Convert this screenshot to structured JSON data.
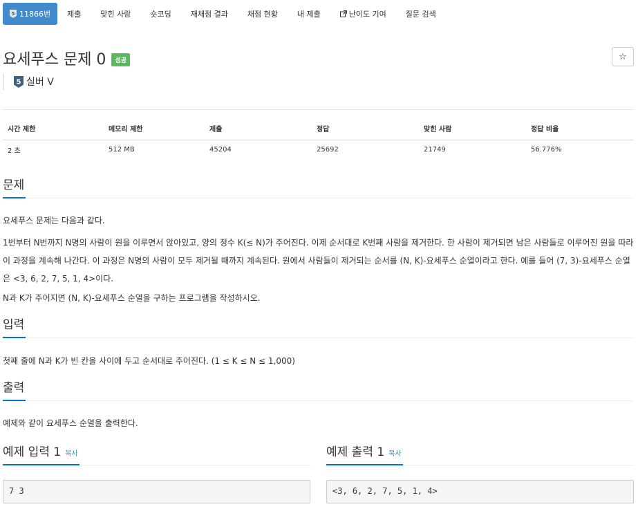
{
  "nav": {
    "problem_number": "11866번",
    "items": [
      "제출",
      "맞힌 사람",
      "숏코딩",
      "재채점 결과",
      "채점 현황",
      "내 제출",
      "난이도 기여",
      "질문 검색"
    ]
  },
  "problem": {
    "title": "요세푸스 문제 0",
    "badge": "성공",
    "star": "☆",
    "tier_digit": "5",
    "tier_label": "실버 V"
  },
  "info": {
    "headers": [
      "시간 제한",
      "메모리 제한",
      "제출",
      "정답",
      "맞힌 사람",
      "정답 비율"
    ],
    "values": [
      "2 초",
      "512 MB",
      "45204",
      "25692",
      "21749",
      "56.776%"
    ]
  },
  "sections": {
    "problem_heading": "문제",
    "problem_p1": "요세푸스 문제는 다음과 같다.",
    "problem_p2": "1번부터 N번까지 N명의 사람이 원을 이루면서 앉아있고, 양의 정수 K(≤ N)가 주어진다. 이제 순서대로 K번째 사람을 제거한다. 한 사람이 제거되면 남은 사람들로 이루어진 원을 따라 이 과정을 계속해 나간다. 이 과정은 N명의 사람이 모두 제거될 때까지 계속된다. 원에서 사람들이 제거되는 순서를 (N, K)-요세푸스 순열이라고 한다. 예를 들어 (7, 3)-요세푸스 순열은 <3, 6, 2, 7, 5, 1, 4>이다.",
    "problem_p3": "N과 K가 주어지면 (N, K)-요세푸스 순열을 구하는 프로그램을 작성하시오.",
    "input_heading": "입력",
    "input_text": "첫째 줄에 N과 K가 빈 칸을 사이에 두고 순서대로 주어진다. (1 ≤ K ≤ N ≤ 1,000)",
    "output_heading": "출력",
    "output_text": "예제와 같이 요세푸스 순열을 출력한다."
  },
  "samples": {
    "input_heading": "예제 입력 1",
    "output_heading": "예제 출력 1",
    "copy_label": "복사",
    "input_value": "7 3",
    "output_value": "<3, 6, 2, 7, 5, 1, 4>"
  },
  "colors": {
    "primary": "#428bca",
    "success": "#5cb85c",
    "headline_underline": "#0076c0",
    "tier_silver": "#435f7a"
  }
}
